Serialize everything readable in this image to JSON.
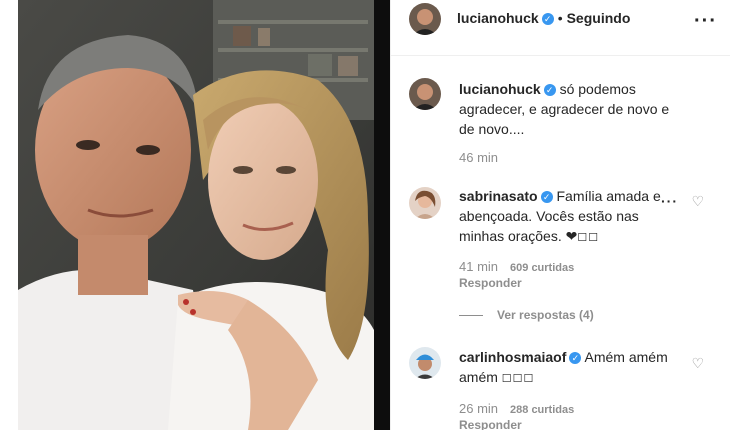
{
  "post": {
    "author": "lucianohuck",
    "follow_state": "Seguindo",
    "more_icon": "more-options-icon"
  },
  "comments": [
    {
      "username": "lucianohuck",
      "text": "só podemos agradecer, e agradecer de novo e de novo....",
      "time": "46 min"
    },
    {
      "username": "sabrinasato",
      "text": "Família amada e abençoada. Vocês estão nas minhas orações. ❤",
      "tail": "☐☐",
      "time": "41 min",
      "likes": "609 curtidas",
      "reply": "Responder",
      "view_replies": "Ver respostas (4)"
    },
    {
      "username": "carlinhosmaiaof",
      "text": "Amém amém amém",
      "tail": "☐☐☐",
      "time": "26 min",
      "likes": "288 curtidas",
      "reply": "Responder"
    }
  ],
  "colors": {
    "verified": "#3897f0",
    "muted": "#8e8e8e",
    "text": "#262626"
  }
}
